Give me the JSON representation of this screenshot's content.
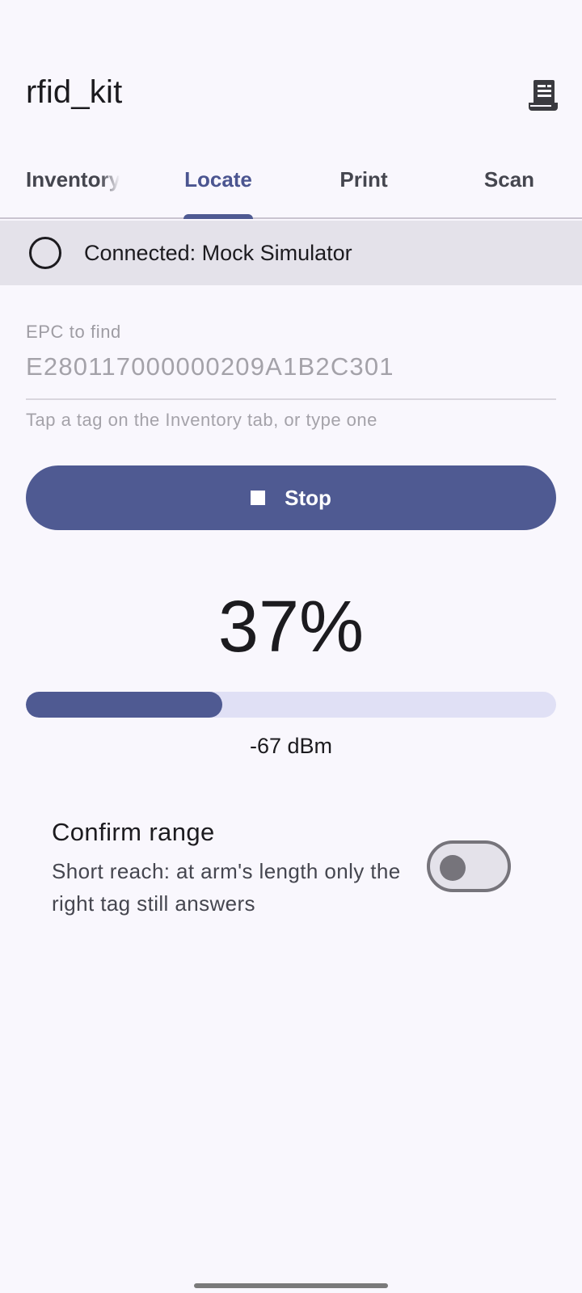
{
  "app": {
    "title": "rfid_kit",
    "printer_icon": "printer-queue-icon"
  },
  "tabs": [
    {
      "label": "Inventory",
      "active": false
    },
    {
      "label": "Locate",
      "active": true
    },
    {
      "label": "Print",
      "active": false
    },
    {
      "label": "Scan",
      "active": false
    }
  ],
  "status": {
    "icon": "circle-outline-icon",
    "text": "Connected: Mock Simulator"
  },
  "epc_field": {
    "label": "EPC to find",
    "value": "E280117000000209A1B2C301",
    "helper": "Tap a tag on the Inventory tab, or type one"
  },
  "stop_button": {
    "icon": "stop-square-icon",
    "label": "Stop"
  },
  "signal": {
    "percent_text": "37%",
    "percent_value": 0.37,
    "rssi_text": "-67 dBm"
  },
  "confirm_range": {
    "title": "Confirm range",
    "subtitle": "Short reach: at arm's length only the right tag still answers",
    "enabled": false
  },
  "colors": {
    "accent": "#4f5a92",
    "track": "#e0e0f5",
    "status_bg": "#e4e2ea",
    "background": "#f9f7fd"
  }
}
